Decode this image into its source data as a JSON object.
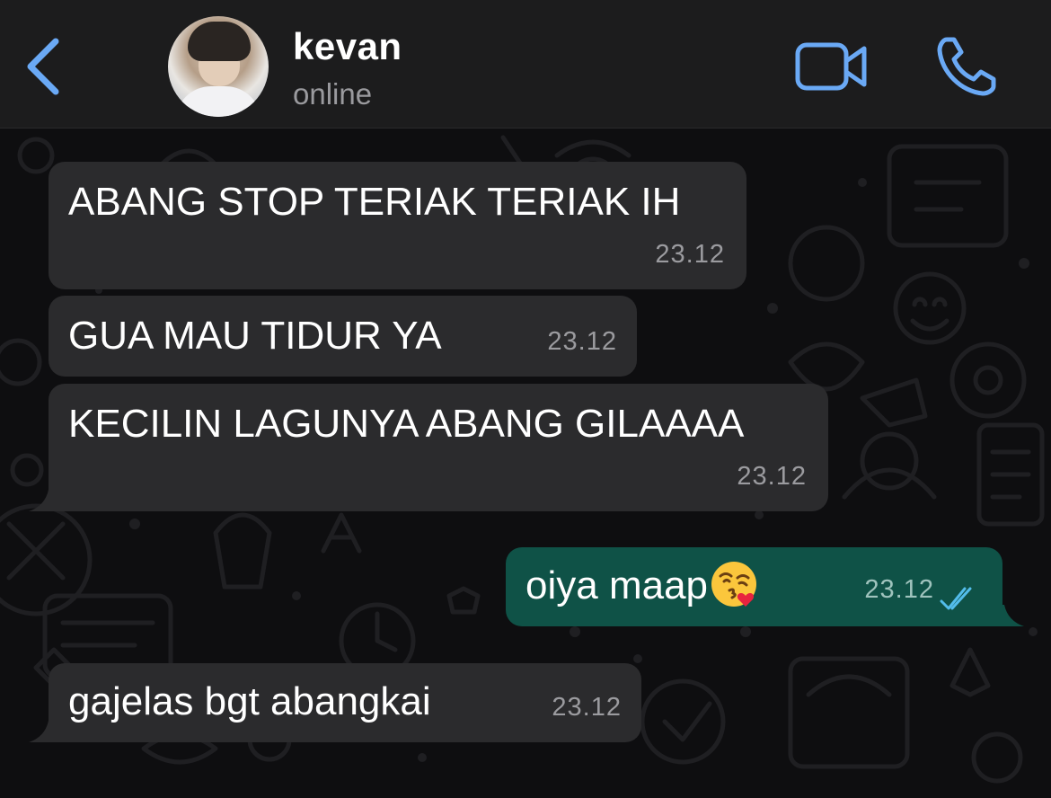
{
  "header": {
    "contact_name": "kevan",
    "contact_status": "online",
    "accent_color": "#6aa9f5"
  },
  "messages": [
    {
      "direction": "incoming",
      "text": "ABANG STOP TERIAK TERIAK IH",
      "time": "23.12"
    },
    {
      "direction": "incoming",
      "text": "GUA MAU TIDUR YA",
      "time": "23.12"
    },
    {
      "direction": "incoming",
      "text": "KECILIN LAGUNYA ABANG GILAAAA",
      "time": "23.12"
    },
    {
      "direction": "outgoing",
      "text": "oiya maap",
      "emoji": "kissing-face-with-heart",
      "time": "23.12",
      "status": "read"
    },
    {
      "direction": "incoming",
      "text": "gajelas bgt abangkai",
      "time": "23.12"
    }
  ],
  "colors": {
    "incoming_bubble": "#2b2b2d",
    "outgoing_bubble": "#0f5247",
    "read_ticks": "#53bdeb"
  }
}
